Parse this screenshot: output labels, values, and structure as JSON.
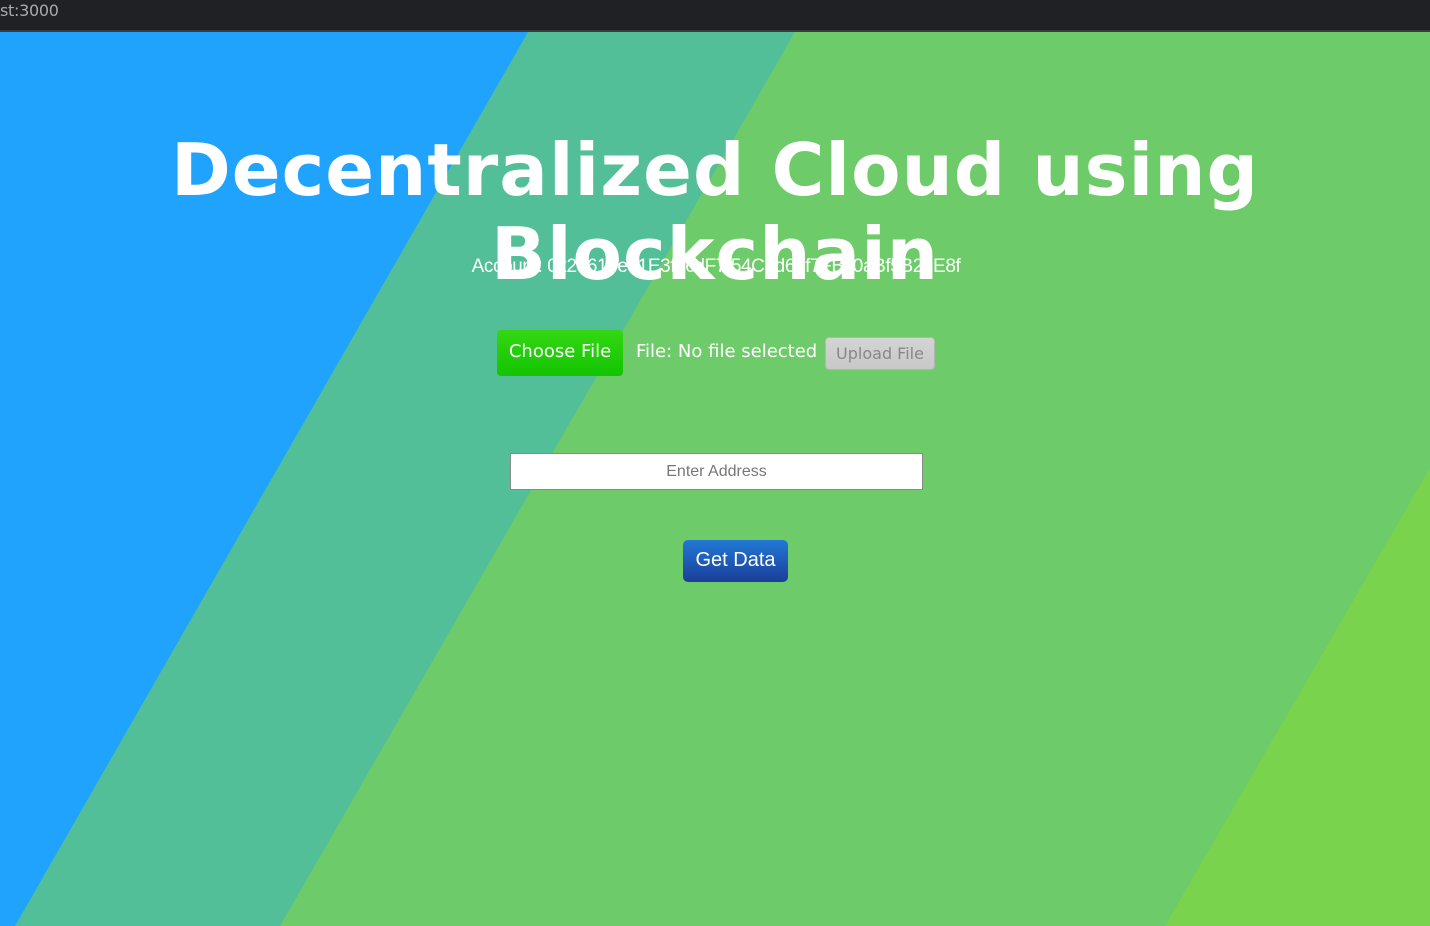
{
  "browser": {
    "url": "st:3000"
  },
  "page": {
    "title": "Decentralized Cloud using Blockchain",
    "account_text": "Account: 0x23618e81E3f5cdF7f54C3d65f7FBc0aBf5B21E8f"
  },
  "upload": {
    "choose_label": "Choose File",
    "file_status": "File: No file selected",
    "upload_label": "Upload File"
  },
  "retrieve": {
    "address_placeholder": "Enter Address",
    "address_value": "",
    "get_data_label": "Get Data"
  },
  "colors": {
    "blue": "#1fa3fd",
    "teal": "#52bf98",
    "green": "#6dcb69",
    "lime": "#7ad34c",
    "choose_button": "#13c400",
    "get_data_button": "#1a3e9a"
  }
}
